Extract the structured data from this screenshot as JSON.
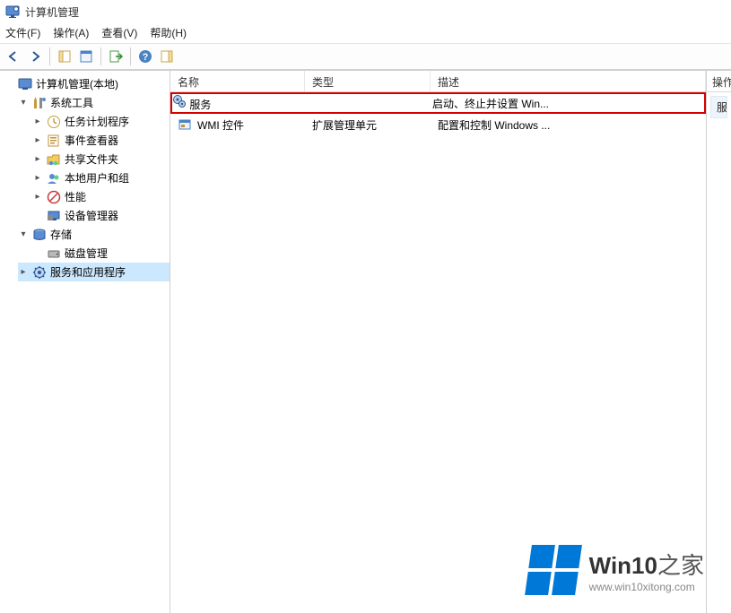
{
  "window": {
    "title": "计算机管理"
  },
  "menubar": {
    "file": "文件(F)",
    "action": "操作(A)",
    "view": "查看(V)",
    "help": "帮助(H)"
  },
  "tree": {
    "root": "计算机管理(本地)",
    "system_tools": "系统工具",
    "task_scheduler": "任务计划程序",
    "event_viewer": "事件查看器",
    "shared_folders": "共享文件夹",
    "local_users": "本地用户和组",
    "performance": "性能",
    "device_manager": "设备管理器",
    "storage": "存储",
    "disk_mgmt": "磁盘管理",
    "services_apps": "服务和应用程序"
  },
  "list": {
    "columns": {
      "name": "名称",
      "type": "类型",
      "desc": "描述"
    },
    "rows": [
      {
        "icon": "services-icon",
        "name": "服务",
        "type": "",
        "desc": "启动、终止并设置 Win...",
        "highlight": true
      },
      {
        "icon": "wmi-icon",
        "name": "WMI 控件",
        "type": "扩展管理单元",
        "desc": "配置和控制 Windows ...",
        "highlight": false
      }
    ]
  },
  "actions": {
    "header": "操作",
    "item1": "服务"
  },
  "watermark": {
    "brand_strong": "Win10",
    "brand_light": "之家",
    "url": "www.win10xitong.com"
  }
}
